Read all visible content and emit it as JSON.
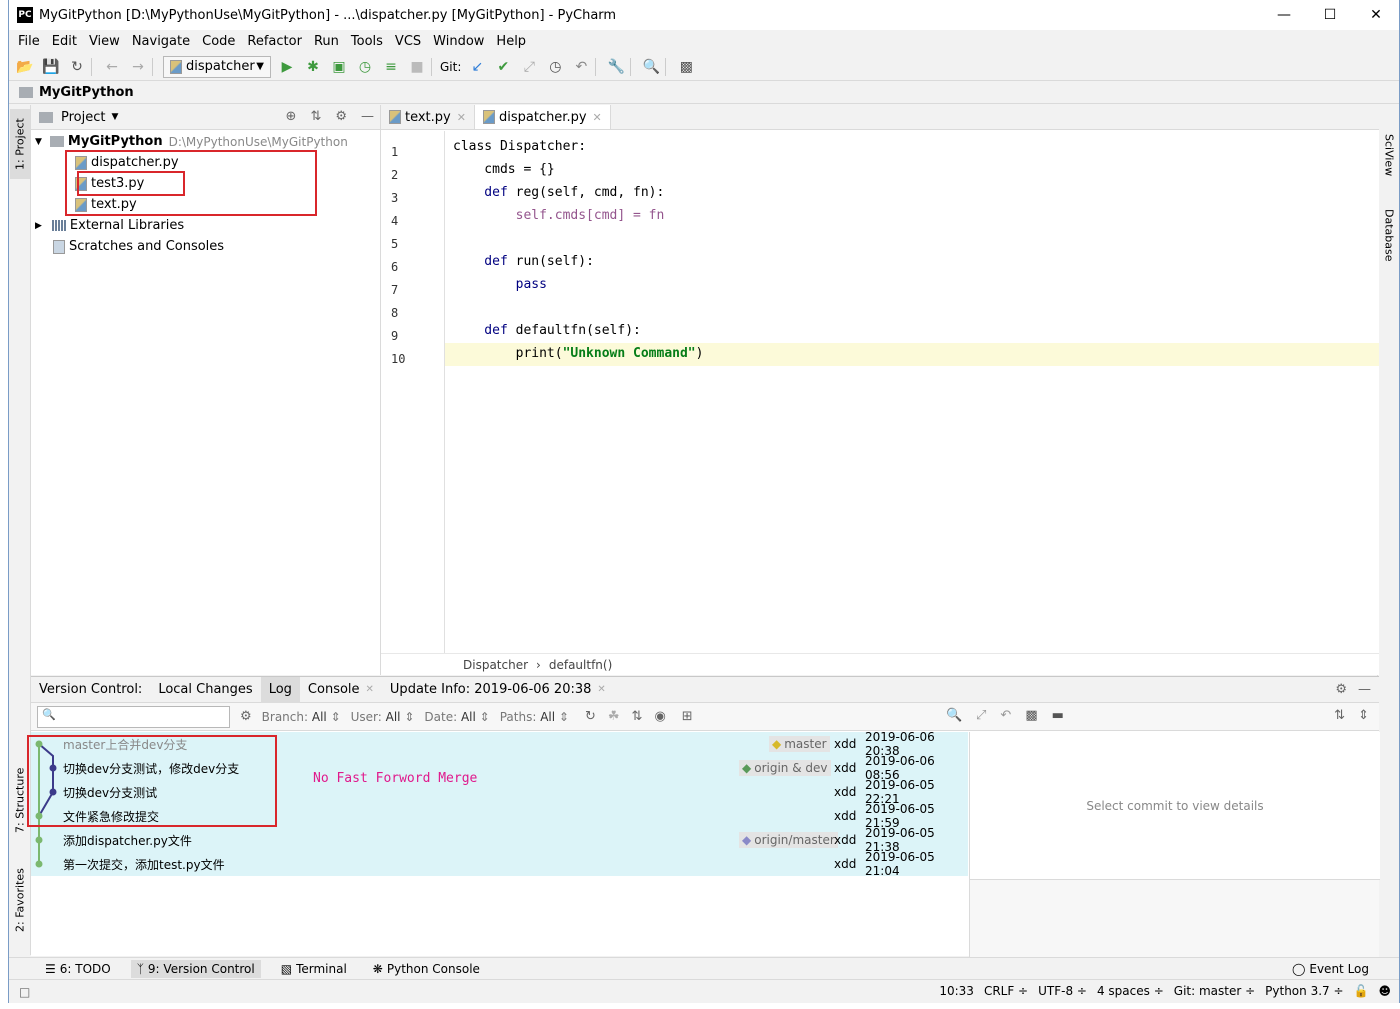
{
  "window": {
    "title": "MyGitPython [D:\\MyPythonUse\\MyGitPython] - ...\\dispatcher.py [MyGitPython] - PyCharm",
    "logo": "PC"
  },
  "menu": [
    "File",
    "Edit",
    "View",
    "Navigate",
    "Code",
    "Refactor",
    "Run",
    "Tools",
    "VCS",
    "Window",
    "Help"
  ],
  "toolbar": {
    "run_config": "dispatcher",
    "git_label": "Git:"
  },
  "navbar": {
    "project": "MyGitPython"
  },
  "left_strip": {
    "project_tab": "1: Project",
    "structure_tab": "7: Structure",
    "favorites_tab": "2: Favorites"
  },
  "right_strip": {
    "sciview_tab": "SciView",
    "database_tab": "Database"
  },
  "project_panel": {
    "header": "Project",
    "root_name": "MyGitPython",
    "root_path": "D:\\MyPythonUse\\MyGitPython",
    "files": [
      "dispatcher.py",
      "test3.py",
      "text.py"
    ],
    "external": "External Libraries",
    "scratches": "Scratches and Consoles"
  },
  "editor": {
    "tabs": [
      {
        "label": "text.py"
      },
      {
        "label": "dispatcher.py"
      }
    ],
    "line_numbers": [
      "1",
      "2",
      "3",
      "4",
      "5",
      "6",
      "7",
      "8",
      "9",
      "10"
    ],
    "lines": {
      "l1": "class Dispatcher:",
      "l2": "    cmds = {}",
      "l3a": "    def ",
      "l3b": "reg(self, cmd, fn):",
      "l4": "        self.cmds[cmd] = fn",
      "l6a": "    def ",
      "l6b": "run(self):",
      "l7": "        pass",
      "l9a": "    def ",
      "l9b": "defaultfn(self):",
      "l10a": "        print(",
      "l10b": "\"Unknown Command\"",
      "l10c": ")"
    },
    "breadcrumb": {
      "class": "Dispatcher",
      "sep": "›",
      "method": "defaultfn()"
    }
  },
  "vc": {
    "tabs": [
      "Version Control:",
      "Local Changes",
      "Log",
      "Console",
      "Update Info: 2019-06-06 20:38"
    ],
    "filters": {
      "branch": "Branch:",
      "branch_val": "All",
      "user": "User:",
      "user_val": "All",
      "date": "Date:",
      "date_val": "All",
      "paths": "Paths:",
      "paths_val": "All"
    },
    "annotation": "No Fast Forword Merge",
    "commits": [
      {
        "msg": "master上合并dev分支",
        "tag": "master",
        "author": "xdd",
        "date": "2019-06-06 20:38"
      },
      {
        "msg": "切换dev分支测试，修改dev分支",
        "tag": "origin & dev",
        "author": "xdd",
        "date": "2019-06-06 08:56"
      },
      {
        "msg": "切换dev分支测试",
        "tag": "",
        "author": "xdd",
        "date": "2019-06-05 22:21"
      },
      {
        "msg": "文件紧急修改提交",
        "tag": "",
        "author": "xdd",
        "date": "2019-06-05 21:59"
      },
      {
        "msg": "添加dispatcher.py文件",
        "tag": "origin/master",
        "author": "xdd",
        "date": "2019-06-05 21:38"
      },
      {
        "msg": "第一次提交，添加test.py文件",
        "tag": "",
        "author": "xdd",
        "date": "2019-06-05 21:04"
      }
    ],
    "details_placeholder": "Select commit to view details"
  },
  "bottom_tabs": [
    "6: TODO",
    "9: Version Control",
    "Terminal",
    "Python Console"
  ],
  "event_log": "Event Log",
  "status": {
    "pos": "10:33",
    "crlf": "CRLF ÷",
    "enc": "UTF-8 ÷",
    "indent": "4 spaces ÷",
    "git": "Git: master ÷",
    "python": "Python 3.7 ÷"
  },
  "colors": {
    "accent_red": "#d9262b",
    "commit_bg": "#dcf4f8",
    "annotation": "#e0198c",
    "string": "#067d17",
    "keyword": "#000080"
  }
}
